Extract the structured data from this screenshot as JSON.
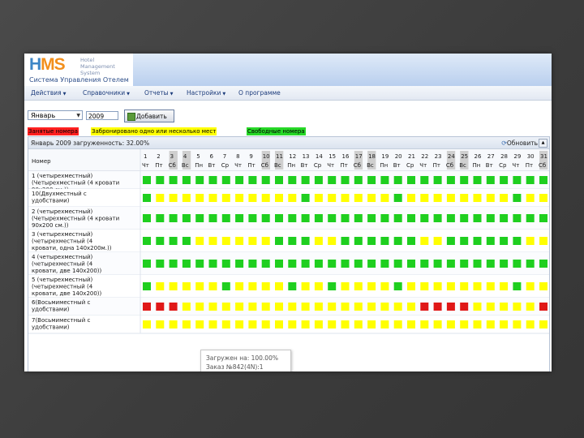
{
  "app": {
    "logo_h": "H",
    "logo_ms": "MS",
    "logo_sub": [
      "Hotel",
      "Management",
      "System"
    ],
    "system_name": "Система Управления Отелем"
  },
  "menu": [
    {
      "label": "Действия",
      "has_dropdown": true
    },
    {
      "label": "Справочники",
      "has_dropdown": true
    },
    {
      "label": "Отчеты",
      "has_dropdown": true
    },
    {
      "label": "Настройки",
      "has_dropdown": true
    },
    {
      "label": "О программе",
      "has_dropdown": false
    }
  ],
  "controls": {
    "month_value": "Январь",
    "year_value": "2009",
    "add_button_label": "Добавить"
  },
  "legend": [
    {
      "label": "Занятые номера",
      "color": "#ff2020"
    },
    {
      "label": "Забронировано одно или несколько мест",
      "color": "#ffff00"
    },
    {
      "label": "Свободные номера",
      "color": "#27d827"
    }
  ],
  "grid": {
    "title": "Январь 2009   загруженность: 32.00%",
    "refresh_label": "Обновить",
    "room_header": "Номер",
    "days": [
      "1",
      "2",
      "3",
      "4",
      "5",
      "6",
      "7",
      "8",
      "9",
      "10",
      "11",
      "12",
      "13",
      "14",
      "15",
      "16",
      "17",
      "18",
      "19",
      "20",
      "21",
      "22",
      "23",
      "24",
      "25",
      "26",
      "27",
      "28",
      "29",
      "30",
      "31"
    ],
    "weekdays": [
      "Чт",
      "Пт",
      "Сб",
      "Вс",
      "Пн",
      "Вт",
      "Ср",
      "Чт",
      "Пт",
      "Сб",
      "Вс",
      "Пн",
      "Вт",
      "Ср",
      "Чт",
      "Пт",
      "Сб",
      "Вс",
      "Пн",
      "Вт",
      "Ср",
      "Чт",
      "Пт",
      "Сб",
      "Вс",
      "Пн",
      "Вт",
      "Ср",
      "Чт",
      "Пт",
      "Сб"
    ],
    "rooms": [
      {
        "lines": [
          "1 (четырехместный)",
          "(Четырехместный (4 кровати",
          "90x200 см.))"
        ],
        "status": "GGGGGGGGGGGGGGGGGGGGGGGGGGGGGGG"
      },
      {
        "lines": [
          "10(Двухместный с",
          "удобствами)"
        ],
        "status": "GYYYYYYYYYYYGYYYYYYGYYYYYYYYGYY"
      },
      {
        "lines": [
          "2 (четырехместный)",
          "(Четырехместный (4 кровати",
          "90x200 см.))"
        ],
        "status": "GGGGGGGGGGGGGGGGGGGGGGGGGGGGGGG"
      },
      {
        "lines": [
          "3 (четырехместный)",
          "(четырехместный (4",
          "кровати, одна 140x200м.))"
        ],
        "status": "GGGGYYYYYYGGGYYGGGGGGYYGGGGGGYY"
      },
      {
        "lines": [
          "4 (четырехместный)",
          "(четырехместный (4",
          "кровати, две 140x200))"
        ],
        "status": "GGGGGGGGGGGGGGGGGGGGGGGGGGGGGGG"
      },
      {
        "lines": [
          "5 (четырехместный)",
          "(четырехместный (4",
          "кровати, две 140x200))"
        ],
        "status": "GYYYYYGYYYYGYYGYYYYGYYYYYYYYGYY"
      },
      {
        "lines": [
          "6(Восьмиместный с",
          "удобствами)"
        ],
        "status": "RRRYYYYYYYYYYYYYYYYYYRRRRYYYYYR"
      },
      {
        "lines": [
          "7(Восьмиместный с",
          "удобствами)"
        ],
        "status": "YYYYYYYYYYYYYYYYYYYYYYYYYYYYYYY"
      }
    ],
    "weekend_days": [
      "3",
      "4",
      "10",
      "11",
      "17",
      "18",
      "24",
      "25",
      "31"
    ],
    "status_colors": {
      "G": "#1fcf1f",
      "Y": "#ffff00",
      "R": "#e01818"
    }
  },
  "tooltip": {
    "line1": "Загружен на: 100.00%",
    "line2": "Заказ №842(4N):1"
  }
}
